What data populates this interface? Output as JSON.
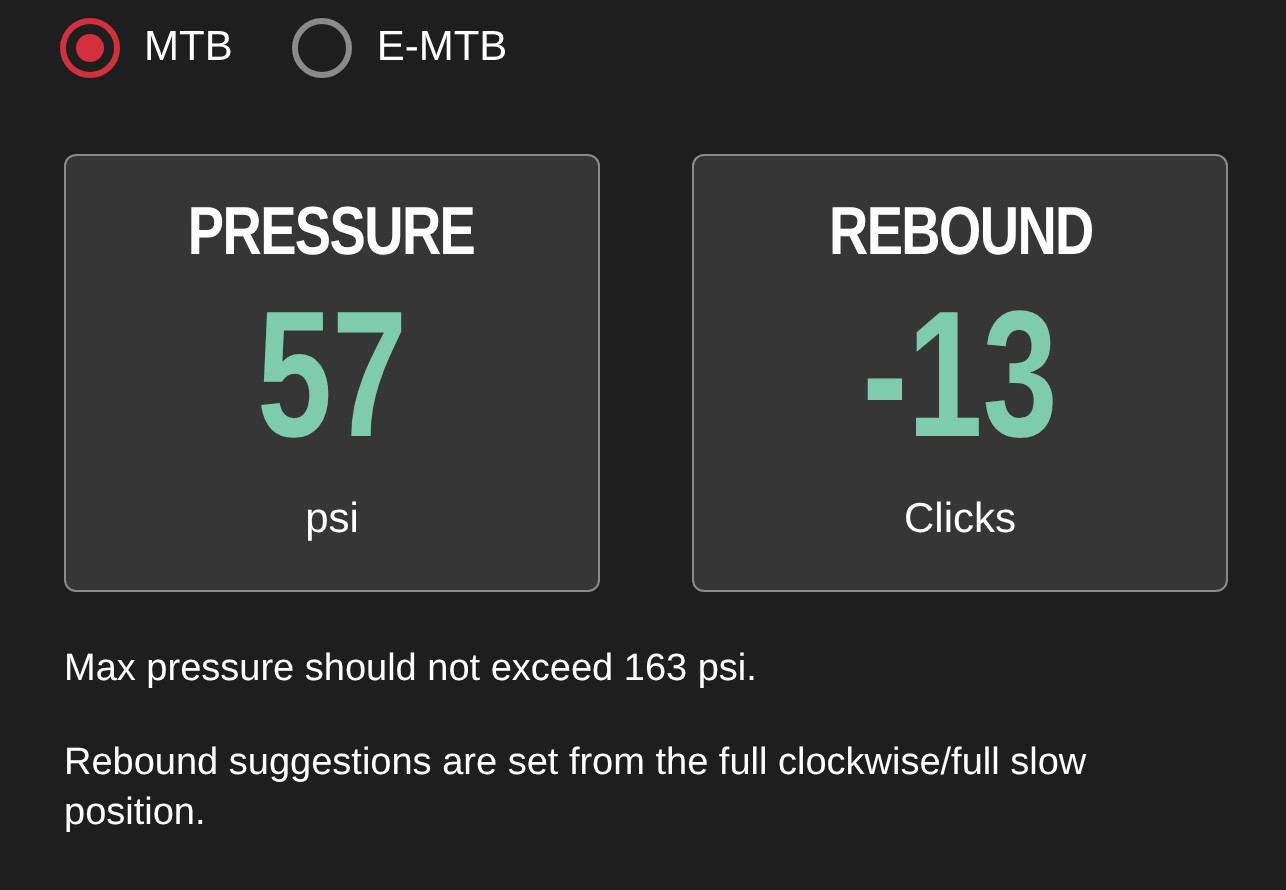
{
  "bike_types": [
    {
      "label": "MTB",
      "selected": true
    },
    {
      "label": "E-MTB",
      "selected": false
    }
  ],
  "cards": [
    {
      "title": "PRESSURE",
      "value": "57",
      "unit": "psi"
    },
    {
      "title": "REBOUND",
      "value": "-13",
      "unit": "Clicks"
    }
  ],
  "notes": [
    "Max pressure should not exceed 163 psi.",
    "Rebound suggestions are set from the full clockwise/full slow position."
  ]
}
